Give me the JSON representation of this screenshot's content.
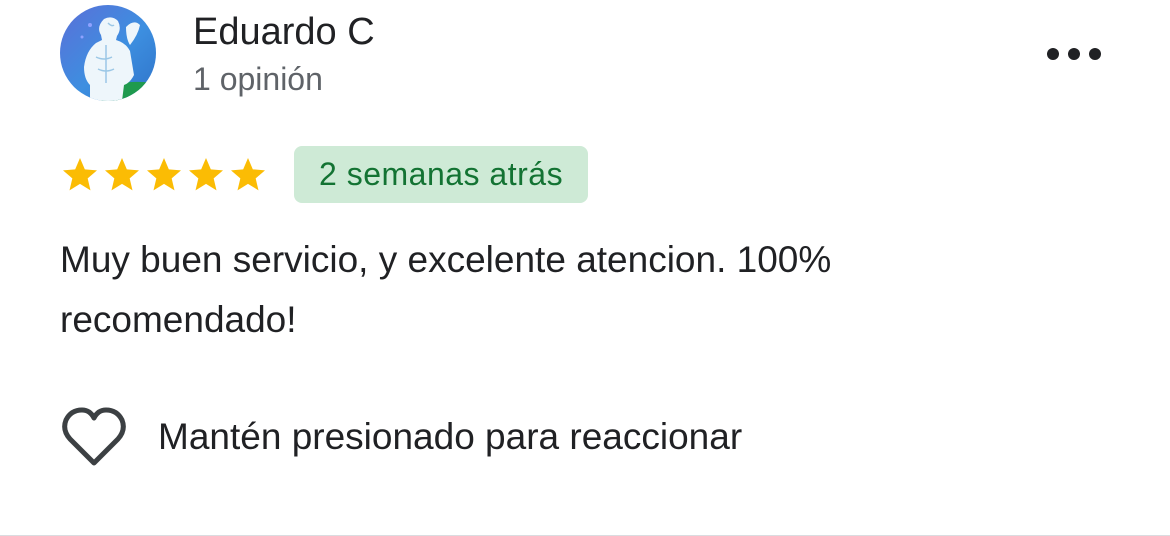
{
  "reviewer": {
    "name": "Eduardo C",
    "review_count": "1 opinión",
    "avatar_icon": "profile-avatar-statue"
  },
  "menu": {
    "icon": "more-horizontal-icon"
  },
  "rating": {
    "stars": 5,
    "max_stars": 5,
    "star_color": "#fbbc04",
    "time_ago": "2 semanas atrás",
    "badge_bg": "#ceead6",
    "badge_text_color": "#137333"
  },
  "review": {
    "text": "Muy buen servicio, y excelente atencion. 100% recomendado!"
  },
  "reaction": {
    "icon": "heart-outline-icon",
    "label": "Mantén presionado para reaccionar"
  }
}
